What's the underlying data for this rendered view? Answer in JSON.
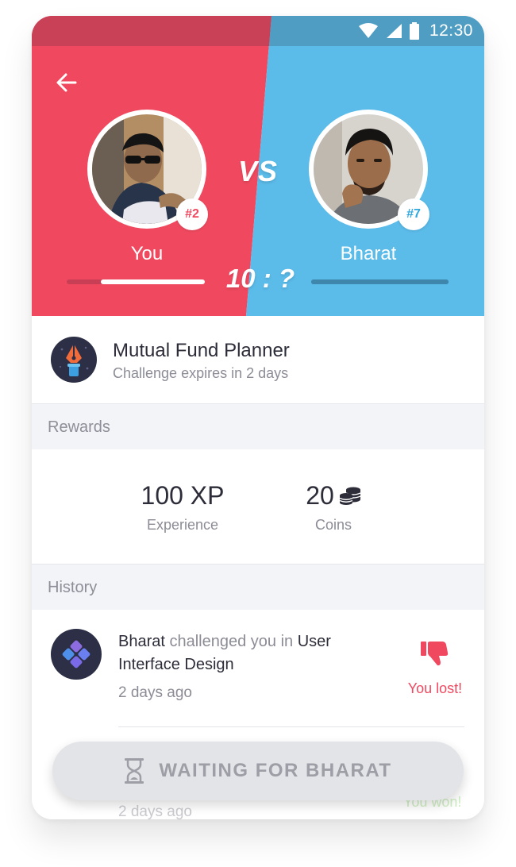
{
  "status_bar": {
    "time": "12:30",
    "icons": [
      "wifi-icon",
      "signal-icon",
      "battery-icon"
    ]
  },
  "header": {
    "back_icon": "arrow-left-icon",
    "vs_label": "VS",
    "score": "10 : ?",
    "colors": {
      "you": "#f0495f",
      "opponent": "#5bbbe9"
    },
    "you": {
      "name": "You",
      "rank": "#2",
      "progress": 0.75
    },
    "opponent": {
      "name": "Bharat",
      "rank": "#7",
      "progress": 1.0
    }
  },
  "challenge": {
    "title": "Mutual Fund Planner",
    "subtitle": "Challenge expires in 2 days",
    "icon": "pen-nib-icon"
  },
  "rewards": {
    "heading": "Rewards",
    "items": [
      {
        "value": "100 XP",
        "label": "Experience"
      },
      {
        "value": "20",
        "label": "Coins",
        "icon": "coins-icon"
      }
    ]
  },
  "history": {
    "heading": "History",
    "entries": [
      {
        "actor": "Bharat",
        "text_middle": " challenged you in ",
        "topic": "User Interface Design",
        "time": "2 days ago",
        "result": "You lost!",
        "result_icon": "thumbs-down-icon",
        "result_color": "#f0495f"
      },
      {
        "time": "2 days ago",
        "result": "You won!",
        "result_color": "#b5e3a4"
      }
    ]
  },
  "action_button": {
    "label": "WAITING FOR BHARAT",
    "icon": "hourglass-icon"
  }
}
